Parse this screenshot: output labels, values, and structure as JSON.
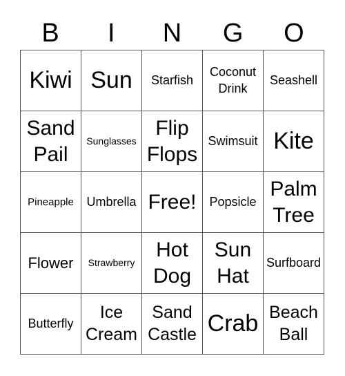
{
  "header": [
    "B",
    "I",
    "N",
    "G",
    "O"
  ],
  "cells": [
    [
      "Kiwi",
      "Sun",
      "Starfish",
      "Coconut\nDrink",
      "Seashell"
    ],
    [
      "Sand\nPail",
      "Sunglasses",
      "Flip\nFlops",
      "Swimsuit",
      "Kite"
    ],
    [
      "Pineapple",
      "Umbrella",
      "Free!",
      "Popsicle",
      "Palm\nTree"
    ],
    [
      "Flower",
      "Strawberry",
      "Hot\nDog",
      "Sun\nHat",
      "Surfboard"
    ],
    [
      "Butterfly",
      "Ice\nCream",
      "Sand\nCastle",
      "Crab",
      "Beach\nBall"
    ]
  ]
}
